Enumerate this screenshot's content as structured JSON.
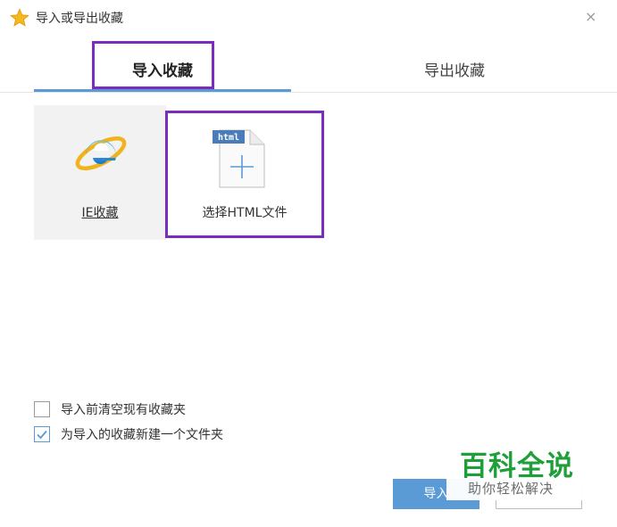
{
  "window": {
    "title": "导入或导出收藏",
    "close_symbol": "×",
    "icon": "star-icon"
  },
  "tabs": [
    {
      "label": "导入收藏",
      "active": true
    },
    {
      "label": "导出收藏",
      "active": false
    }
  ],
  "sources": [
    {
      "label": "IE收藏",
      "icon": "ie-browser-icon",
      "selected": false
    },
    {
      "label": "选择HTML文件",
      "icon": "html-file-add-icon",
      "file_badge": "html",
      "selected": true
    }
  ],
  "options": [
    {
      "label": "导入前清空现有收藏夹",
      "checked": false
    },
    {
      "label": "为导入的收藏新建一个文件夹",
      "checked": true
    }
  ],
  "buttons": {
    "import_label": "导入",
    "cancel_label": ""
  },
  "watermark": {
    "title": "百科全说",
    "subtitle": "助你轻松解决"
  },
  "colors": {
    "accent": "#5b9bd5",
    "highlight_outline": "#7a2cbf",
    "watermark_green": "#1f9f3a"
  }
}
